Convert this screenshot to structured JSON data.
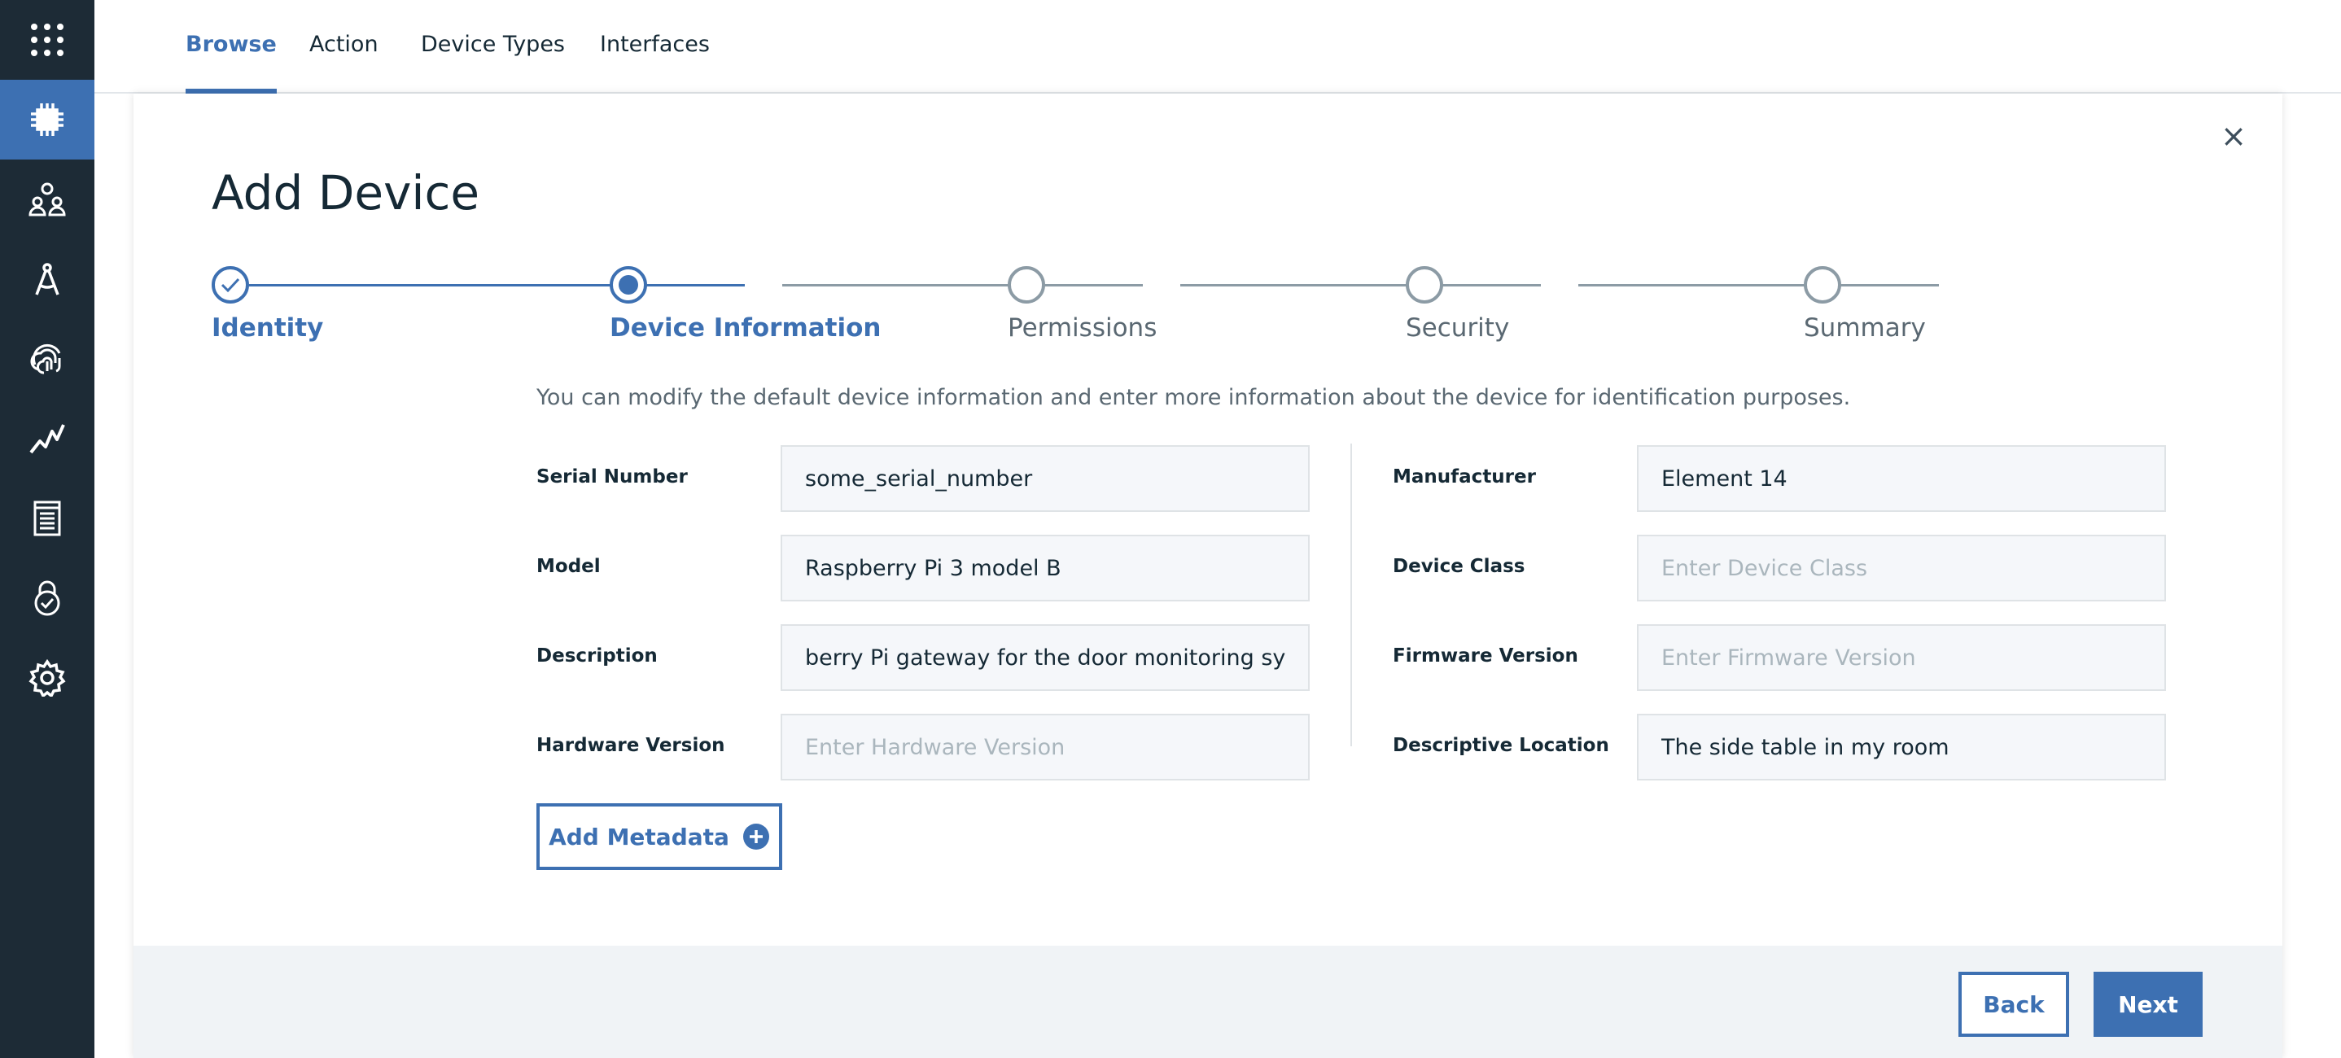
{
  "nav_tabs": [
    {
      "label": "Browse",
      "active": true
    },
    {
      "label": "Action",
      "active": false
    },
    {
      "label": "Device Types",
      "active": false
    },
    {
      "label": "Interfaces",
      "active": false
    }
  ],
  "sidebar": {
    "icons": [
      "apps-grid-icon",
      "chip-icon",
      "members-icon",
      "compass-icon",
      "fingerprint-icon",
      "analytics-icon",
      "document-icon",
      "security-lock-icon",
      "gear-icon"
    ],
    "active_index": 1
  },
  "modal": {
    "title": "Add Device",
    "close_icon": "×",
    "steps": [
      {
        "label": "Identity",
        "state": "done"
      },
      {
        "label": "Device Information",
        "state": "current"
      },
      {
        "label": "Permissions",
        "state": "pending"
      },
      {
        "label": "Security",
        "state": "pending"
      },
      {
        "label": "Summary",
        "state": "pending"
      }
    ],
    "intro": "You can modify the default device information and enter more information about the device for identification purposes.",
    "left_fields": [
      {
        "label": "Serial Number",
        "value": "some_serial_number",
        "placeholder": ""
      },
      {
        "label": "Model",
        "value": "Raspberry Pi 3 model B",
        "placeholder": ""
      },
      {
        "label": "Description",
        "value": "berry Pi gateway for the door monitoring system",
        "placeholder": ""
      },
      {
        "label": "Hardware Version",
        "value": "",
        "placeholder": "Enter Hardware Version"
      }
    ],
    "right_fields": [
      {
        "label": "Manufacturer",
        "value": "Element 14",
        "placeholder": ""
      },
      {
        "label": "Device Class",
        "value": "",
        "placeholder": "Enter Device Class"
      },
      {
        "label": "Firmware Version",
        "value": "",
        "placeholder": "Enter Firmware Version"
      },
      {
        "label": "Descriptive Location",
        "value": "The side table in my room",
        "placeholder": ""
      }
    ],
    "add_metadata_label": "Add Metadata",
    "back_label": "Back",
    "next_label": "Next"
  },
  "colors": {
    "accent": "#3d70b2",
    "sidebar_bg": "#1d2b36",
    "footer_bg": "#f0f3f6"
  }
}
